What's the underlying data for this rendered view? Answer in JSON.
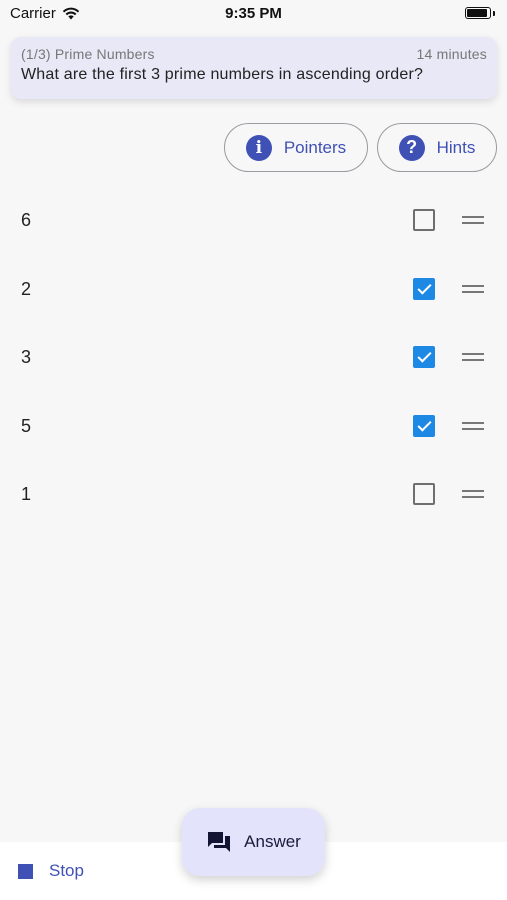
{
  "status_bar": {
    "carrier": "Carrier",
    "time": "9:35 PM"
  },
  "question": {
    "progress_title": "(1/3) Prime Numbers",
    "time_left": "14 minutes",
    "text": "What are the first 3 prime numbers in ascending order?"
  },
  "actions": {
    "pointers_label": "Pointers",
    "pointers_icon": "info-icon",
    "hints_label": "Hints",
    "hints_icon": "help-icon"
  },
  "options": [
    {
      "value": "6",
      "checked": false
    },
    {
      "value": "2",
      "checked": true
    },
    {
      "value": "3",
      "checked": true
    },
    {
      "value": "5",
      "checked": true
    },
    {
      "value": "1",
      "checked": false
    }
  ],
  "bottom": {
    "stop_label": "Stop",
    "answer_label": "Answer",
    "answer_icon": "chat-icon"
  },
  "colors": {
    "accent": "#3f51b5",
    "checkbox_checked": "#1e88e5",
    "card_bg": "#e8e8f6",
    "fab_bg": "#e3e4fb"
  }
}
